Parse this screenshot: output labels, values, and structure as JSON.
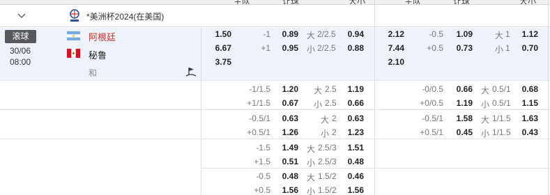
{
  "header": {
    "col_labels": [
      "主队",
      "让球",
      "大小",
      "主队",
      "让球",
      "大小"
    ]
  },
  "league": {
    "name": "*美洲杯2024(在美国)",
    "logo_icon": "copa-america-logo-icon",
    "collapse_icon": "chevron-down-icon"
  },
  "match": {
    "status": "滚球",
    "date": "30/06",
    "time": "08:00",
    "home": "阿根廷",
    "away": "秘鲁",
    "draw": "和",
    "home_flag": "argentina-flag-icon",
    "away_flag": "peru-flag-icon",
    "draw_icon": "flag-marker-icon",
    "ft": {
      "ml": [
        "1.50",
        "6.67",
        "3.75"
      ],
      "hcp": [
        [
          "-1",
          "0.89"
        ],
        [
          "+1",
          "0.95"
        ]
      ],
      "ou": [
        [
          "大",
          "2/2.5",
          "0.94"
        ],
        [
          "小",
          "2/2.5",
          "0.88"
        ]
      ]
    },
    "ht": {
      "ml": [
        "2.12",
        "7.44",
        "2.10"
      ],
      "hcp": [
        [
          "-0.5",
          "1.09"
        ],
        [
          "+0.5",
          "0.73"
        ]
      ],
      "ou": [
        [
          "大",
          "1",
          "1.12"
        ],
        [
          "小",
          "1",
          "0.70"
        ]
      ]
    }
  },
  "extra_lines": [
    {
      "ft_hcp": [
        [
          "-1/1.5",
          "1.20"
        ],
        [
          "+1/1.5",
          "0.67"
        ]
      ],
      "ft_ou": [
        [
          "大",
          "2.5",
          "1.19"
        ],
        [
          "小",
          "2.5",
          "0.66"
        ]
      ],
      "ht_hcp": [
        [
          "-0/0.5",
          "0.66"
        ],
        [
          "+0/0.5",
          "1.19"
        ]
      ],
      "ht_ou": [
        [
          "大",
          "0.5/1",
          "0.68"
        ],
        [
          "小",
          "0.5/1",
          "1.15"
        ]
      ]
    },
    {
      "ft_hcp": [
        [
          "-0.5/1",
          "0.63"
        ],
        [
          "+0.5/1",
          "1.26"
        ]
      ],
      "ft_ou": [
        [
          "大",
          "2",
          "0.63"
        ],
        [
          "小",
          "2",
          "1.23"
        ]
      ],
      "ht_hcp": [
        [
          "-0.5/1",
          "1.58"
        ],
        [
          "+0.5/1",
          "0.45"
        ]
      ],
      "ht_ou": [
        [
          "大",
          "1/1.5",
          "1.63"
        ],
        [
          "小",
          "1/1.5",
          "0.43"
        ]
      ]
    },
    {
      "ft_hcp": [
        [
          "-1.5",
          "1.49"
        ],
        [
          "+1.5",
          "0.51"
        ]
      ],
      "ft_ou": [
        [
          "大",
          "2.5/3",
          "1.51"
        ],
        [
          "小",
          "2.5/3",
          "0.48"
        ]
      ]
    },
    {
      "ft_hcp": [
        [
          "-0.5",
          "0.48"
        ],
        [
          "+0.5",
          "1.56"
        ]
      ],
      "ft_ou": [
        [
          "大",
          "1.5/2",
          "0.46"
        ],
        [
          "小",
          "1.5/2",
          "1.56"
        ]
      ]
    }
  ],
  "colors": {
    "home_team": "#c9312a",
    "badge_bg": "#56585c",
    "match_bg": "#eef3fb"
  }
}
